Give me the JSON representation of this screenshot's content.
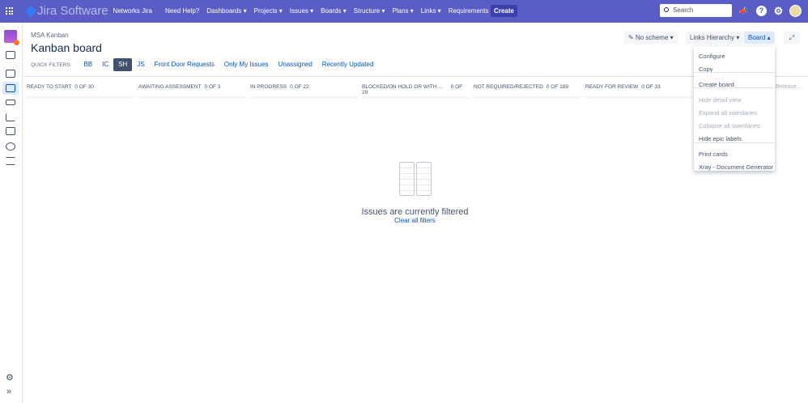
{
  "topnav": {
    "product": "Jira Software",
    "site": "Networks Jira",
    "items": [
      "Need Help?",
      "Dashboards",
      "Projects",
      "Issues",
      "Boards",
      "Structure",
      "Plans",
      "Links",
      "Requirements"
    ],
    "dropdowns": [
      false,
      true,
      true,
      true,
      true,
      true,
      true,
      true,
      true
    ],
    "create": "Create",
    "search_placeholder": "Search",
    "accent": "#5a5dc6"
  },
  "breadcrumb": "MSA Kanban",
  "title": "Kanban board",
  "quick_filters": {
    "label": "QUICK FILTERS:",
    "items": [
      "BB",
      "IC",
      "SH",
      "JS",
      "Front Door Requests",
      "Only My Issues",
      "Unassigned",
      "Recently Updated"
    ],
    "active": "SH"
  },
  "toolbar": {
    "scheme": "No scheme",
    "links": "Links Hierarchy",
    "board": "Board"
  },
  "columns": [
    {
      "name": "READY TO START",
      "count": "0 OF 30"
    },
    {
      "name": "AWAITING ASSESSMENT",
      "count": "0 OF 3"
    },
    {
      "name": "IN PROGRESS",
      "count": "0 OF 22"
    },
    {
      "name": "BLOCKED/ON HOLD OR WITH ...",
      "count": "0 OF 29"
    },
    {
      "name": "NOT REQUIRED/REJECTED",
      "count": "0 OF 189"
    },
    {
      "name": "READY FOR REVIEW",
      "count": "0 OF 33"
    }
  ],
  "release": "Release...",
  "empty": {
    "message": "Issues are currently filtered",
    "link": "Clear all filters"
  },
  "board_menu": [
    {
      "label": "Configure",
      "disabled": false
    },
    {
      "label": "Copy",
      "disabled": false
    },
    {
      "label": "Create board",
      "disabled": false
    },
    {
      "label": "Hide detail view",
      "disabled": true
    },
    {
      "label": "Expand all swimlanes",
      "disabled": true
    },
    {
      "label": "Collapse all swimlanes",
      "disabled": true
    },
    {
      "label": "Hide epic labels",
      "disabled": false
    },
    {
      "label": "Print cards",
      "disabled": false
    },
    {
      "label": "Xray - Document Generator",
      "disabled": false
    }
  ]
}
